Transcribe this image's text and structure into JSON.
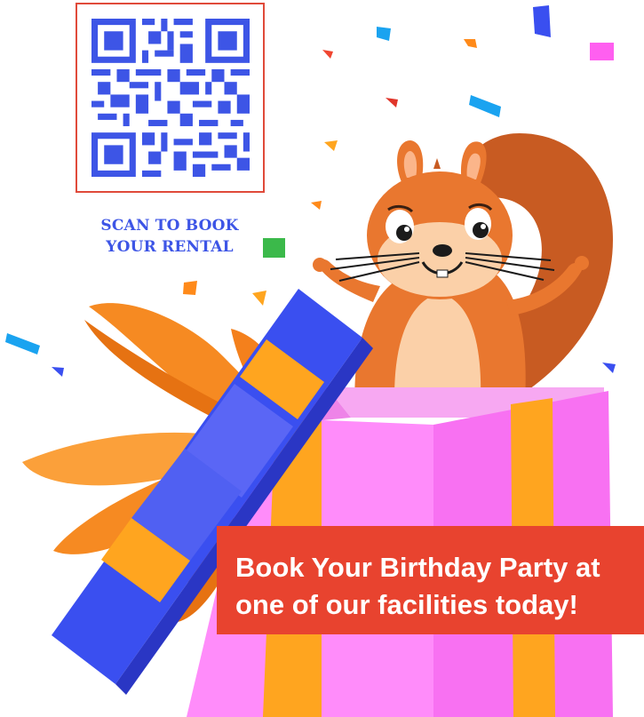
{
  "qr": {
    "icon": "qr-code-icon",
    "color": "#3d55e6",
    "frame_color": "#e04a3a"
  },
  "scan": {
    "line1": "SCAN TO BOOK",
    "line2": "YOUR RENTAL"
  },
  "banner": {
    "line1": "Book Your Birthday Party at",
    "line2": "one of our facilities today!",
    "color": "#e8432f"
  },
  "colors": {
    "box_pink": "#ff7dfa",
    "box_stripe": "#ffa51f",
    "lid_blue": "#5565f0",
    "squirrel": "#e9772f",
    "bow": "#f68a22"
  }
}
